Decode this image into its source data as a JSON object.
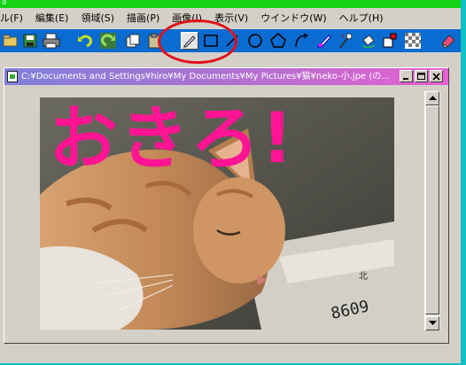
{
  "app": {
    "title_fragment": "d"
  },
  "menu": [
    "ル(F)",
    "編集(E)",
    "領域(S)",
    "描画(P)",
    "画像(I)",
    "表示(V)",
    "ウインドウ(W)",
    "ヘルプ(H)"
  ],
  "toolbar": {
    "buttons": [
      "open-icon",
      "save-icon",
      "print-icon",
      "undo-icon",
      "redo-icon",
      "copy-icon",
      "paste-icon",
      "pen-icon",
      "rectangle-icon",
      "line-icon",
      "ellipse-icon",
      "polygon-icon",
      "curve-icon",
      "fill-icon",
      "spray-icon",
      "bucket-icon",
      "shape-select-icon",
      "pattern-icon",
      "eraser-icon"
    ],
    "highlight_color": "#e0101a",
    "bg_color": "#0a6bd0"
  },
  "document": {
    "title": "C:¥Documents and Settings¥hiro¥My Documents¥My Pictures¥猫¥neko-小.jpe (の..."
  },
  "image": {
    "overlay_text": "おきろ!",
    "overlay_color": "#ff1493",
    "description_icon": "cat-photo"
  },
  "colors": {
    "accent": "#0fc0c4",
    "titlebar": "#13d313"
  }
}
